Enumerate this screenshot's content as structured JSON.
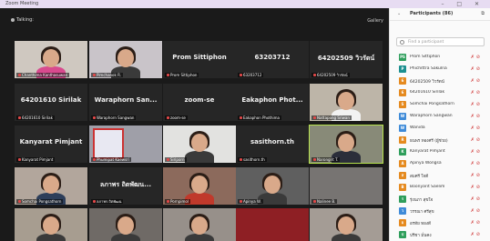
{
  "window": {
    "title": "Zoom Meeting",
    "controls": "–  □  ✕"
  },
  "toolbar": {
    "talking": "Talking:",
    "view": "Gallery"
  },
  "tiles": [
    {
      "label": "Chanthima Kanthasuwan",
      "name": "",
      "video": "woman-pink"
    },
    {
      "label": "Pimchanok R.",
      "name": "",
      "video": "woman-room"
    },
    {
      "label": "Prom Sittiphon",
      "name": "Prom Sittiphon",
      "video": ""
    },
    {
      "label": "63203712",
      "name": "63203712",
      "video": ""
    },
    {
      "label": "64202509 วิวรัตน์",
      "name": "64202509 วิวรัตน์",
      "video": ""
    },
    {
      "label": "64201610 Sirilak",
      "name": "64201610 Sirilak",
      "video": ""
    },
    {
      "label": "Waraphorn Sangwan",
      "name": "Waraphorn  San...",
      "video": ""
    },
    {
      "label": "zoom-se",
      "name": "zoom-se",
      "video": ""
    },
    {
      "label": "Eakaphon Phothima",
      "name": "Eakaphon  Phot...",
      "video": ""
    },
    {
      "label": "Nattapong Sriwan",
      "name": "",
      "video": "man-glasses"
    },
    {
      "label": "Kanyarat Pimjant",
      "name": "Kanyarat Pimjant",
      "video": ""
    },
    {
      "label": "Phumipat Kaewsri",
      "name": "",
      "video": "poster"
    },
    {
      "label": "Siriporn",
      "name": "",
      "video": "woman-bright"
    },
    {
      "label": "sasithorn.th",
      "name": "sasithorn.th",
      "video": ""
    },
    {
      "label": "Narongrit T.",
      "name": "",
      "video": "man-suit"
    },
    {
      "label": "Somchai Pongsathorn",
      "name": "",
      "video": "man-flag"
    },
    {
      "label": "ลภาพร ถิตพัฒน",
      "name": "ลภาพร ถิตพัฒน...",
      "video": ""
    },
    {
      "label": "Pornpimol",
      "name": "",
      "video": "woman-red"
    },
    {
      "label": "Apinya W.",
      "name": "",
      "video": "woman-dark"
    },
    {
      "label": "Nalinee B.",
      "name": "",
      "video": "dim-room"
    },
    {
      "label": "",
      "name": "",
      "video": "man-partial"
    },
    {
      "label": "",
      "name": "",
      "video": "woman-partial"
    },
    {
      "label": "",
      "name": "",
      "video": "woman-partial2"
    },
    {
      "label": "",
      "name": "",
      "video": "red-block"
    },
    {
      "label": "",
      "name": "",
      "video": "woman-partial3"
    }
  ],
  "panel": {
    "title": "Participants (86)",
    "search_placeholder": "Find a participant",
    "participants": [
      {
        "initials": "PS",
        "name": "Prom Sittiphon",
        "color": "#2e9e5b"
      },
      {
        "initials": "P",
        "name": "Phichittra Sakulna",
        "color": "#1b8f8f"
      },
      {
        "initials": "6",
        "name": "64202509 วิวรัตน์",
        "color": "#e58a1f"
      },
      {
        "initials": "6",
        "name": "64201610 Sirilak",
        "color": "#e58a1f"
      },
      {
        "initials": "S",
        "name": "Somchai Pongsathorn",
        "color": "#e58a1f"
      },
      {
        "initials": "W",
        "name": "Waraphorn Sangwan",
        "color": "#3f8bd8"
      },
      {
        "initials": "W",
        "name": "Wanida",
        "color": "#3f8bd8"
      },
      {
        "initials": "R",
        "name": "ธนพร ทองศรี (ผู้ช่วย)",
        "color": "#e58a1f"
      },
      {
        "initials": "K",
        "name": "Kanyarat Pimjant",
        "color": "#2e9e5b"
      },
      {
        "initials": "A",
        "name": "Apinya Wongsa",
        "color": "#e58a1f"
      },
      {
        "initials": "ส",
        "name": "สมศรี ใจดี",
        "color": "#e58a1f"
      },
      {
        "initials": "B",
        "name": "Boonyarit Saelim",
        "color": "#e58a1f"
      },
      {
        "initials": "ร",
        "name": "รุ่งนภา สุขใจ",
        "color": "#2e9e5b"
      },
      {
        "initials": "ว",
        "name": "วรรณา ศรีสุข",
        "color": "#3f8bd8"
      },
      {
        "initials": "อ",
        "name": "อรทัย ทองดี",
        "color": "#e58a1f"
      },
      {
        "initials": "ป",
        "name": "ปรีชา มั่นคง",
        "color": "#2e9e5b"
      },
      {
        "initials": "ม",
        "name": "มาลี",
        "color": "#3f8bd8"
      }
    ]
  }
}
